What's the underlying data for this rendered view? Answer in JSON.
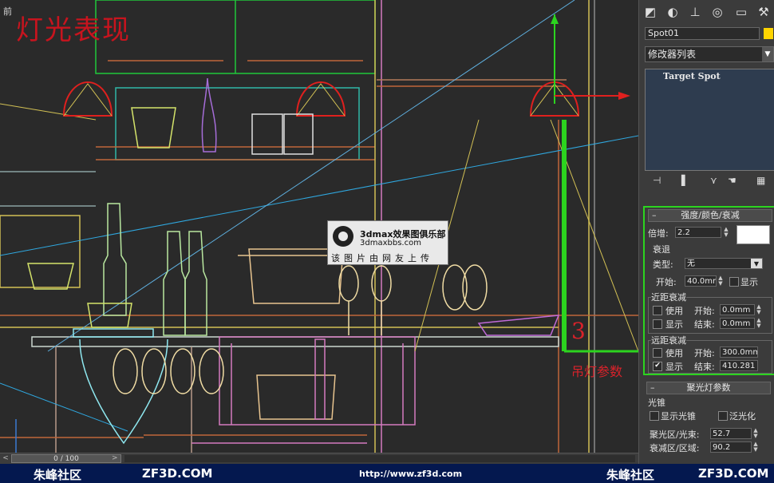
{
  "viewport": {
    "label": "前",
    "title_overlay": "灯光表现",
    "callout_number": "3",
    "callout_label": "吊灯参数",
    "watermark": {
      "line1": "3dmax效果图俱乐部",
      "line2": "3dmaxbbs.com",
      "line3": "该图片由网友上传"
    }
  },
  "timeline": {
    "position": "0 / 100",
    "frame": 0,
    "total": 100
  },
  "footer": {
    "brand_left": "朱峰社区",
    "site_left": "ZF3D.COM",
    "url": "http://www.zf3d.com",
    "brand_right": "朱峰社区",
    "site_right": "ZF3D.COM"
  },
  "panel": {
    "tabs": [
      "create-icon",
      "modify-icon",
      "hierarchy-icon",
      "motion-icon",
      "display-icon",
      "utilities-icon"
    ],
    "object_name": "Spot01",
    "object_color": "#ffd400",
    "modifier_list": "修改器列表",
    "stack_item": "Target Spot",
    "intensity_rollout": {
      "title": "强度/颜色/衰减",
      "multiplier_label": "倍增:",
      "multiplier": "2.2",
      "light_color": "#ffffff",
      "decay_group": "衰退",
      "type_label": "类型:",
      "type_value": "无",
      "start_label": "开始:",
      "start_value": "40.0mm",
      "show_label": "显示",
      "near_group": "近距衰减",
      "near_use": "使用",
      "near_start_label": "开始:",
      "near_start": "0.0mm",
      "near_show": "显示",
      "near_end_label": "结束:",
      "near_end": "0.0mm",
      "far_group": "远距衰减",
      "far_use": "使用",
      "far_start_label": "开始:",
      "far_start": "300.0mm",
      "far_show": "显示",
      "far_end_label": "结束:",
      "far_end": "410.281"
    },
    "spot_rollout": {
      "title": "聚光灯参数",
      "cone_group": "光锥",
      "show_cone": "显示光锥",
      "overshoot": "泛光化",
      "hotspot_label": "聚光区/光束:",
      "hotspot": "52.7",
      "falloff_label": "衰减区/区域:",
      "falloff": "90.2"
    }
  }
}
